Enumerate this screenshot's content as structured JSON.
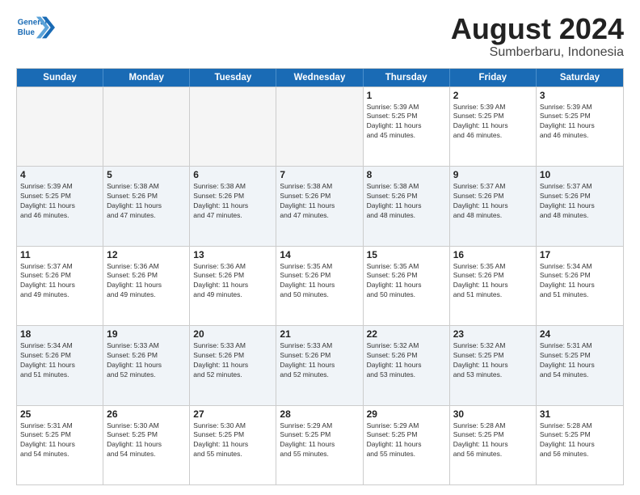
{
  "logo": {
    "text_general": "General",
    "text_blue": "Blue"
  },
  "title": "August 2024",
  "subtitle": "Sumberbaru, Indonesia",
  "days_of_week": [
    "Sunday",
    "Monday",
    "Tuesday",
    "Wednesday",
    "Thursday",
    "Friday",
    "Saturday"
  ],
  "weeks": [
    [
      {
        "day": "",
        "empty": true,
        "info": ""
      },
      {
        "day": "",
        "empty": true,
        "info": ""
      },
      {
        "day": "",
        "empty": true,
        "info": ""
      },
      {
        "day": "",
        "empty": true,
        "info": ""
      },
      {
        "day": "1",
        "info": "Sunrise: 5:39 AM\nSunset: 5:25 PM\nDaylight: 11 hours\nand 45 minutes."
      },
      {
        "day": "2",
        "info": "Sunrise: 5:39 AM\nSunset: 5:25 PM\nDaylight: 11 hours\nand 46 minutes."
      },
      {
        "day": "3",
        "info": "Sunrise: 5:39 AM\nSunset: 5:25 PM\nDaylight: 11 hours\nand 46 minutes."
      }
    ],
    [
      {
        "day": "4",
        "info": "Sunrise: 5:39 AM\nSunset: 5:25 PM\nDaylight: 11 hours\nand 46 minutes."
      },
      {
        "day": "5",
        "info": "Sunrise: 5:38 AM\nSunset: 5:26 PM\nDaylight: 11 hours\nand 47 minutes."
      },
      {
        "day": "6",
        "info": "Sunrise: 5:38 AM\nSunset: 5:26 PM\nDaylight: 11 hours\nand 47 minutes."
      },
      {
        "day": "7",
        "info": "Sunrise: 5:38 AM\nSunset: 5:26 PM\nDaylight: 11 hours\nand 47 minutes."
      },
      {
        "day": "8",
        "info": "Sunrise: 5:38 AM\nSunset: 5:26 PM\nDaylight: 11 hours\nand 48 minutes."
      },
      {
        "day": "9",
        "info": "Sunrise: 5:37 AM\nSunset: 5:26 PM\nDaylight: 11 hours\nand 48 minutes."
      },
      {
        "day": "10",
        "info": "Sunrise: 5:37 AM\nSunset: 5:26 PM\nDaylight: 11 hours\nand 48 minutes."
      }
    ],
    [
      {
        "day": "11",
        "info": "Sunrise: 5:37 AM\nSunset: 5:26 PM\nDaylight: 11 hours\nand 49 minutes."
      },
      {
        "day": "12",
        "info": "Sunrise: 5:36 AM\nSunset: 5:26 PM\nDaylight: 11 hours\nand 49 minutes."
      },
      {
        "day": "13",
        "info": "Sunrise: 5:36 AM\nSunset: 5:26 PM\nDaylight: 11 hours\nand 49 minutes."
      },
      {
        "day": "14",
        "info": "Sunrise: 5:35 AM\nSunset: 5:26 PM\nDaylight: 11 hours\nand 50 minutes."
      },
      {
        "day": "15",
        "info": "Sunrise: 5:35 AM\nSunset: 5:26 PM\nDaylight: 11 hours\nand 50 minutes."
      },
      {
        "day": "16",
        "info": "Sunrise: 5:35 AM\nSunset: 5:26 PM\nDaylight: 11 hours\nand 51 minutes."
      },
      {
        "day": "17",
        "info": "Sunrise: 5:34 AM\nSunset: 5:26 PM\nDaylight: 11 hours\nand 51 minutes."
      }
    ],
    [
      {
        "day": "18",
        "info": "Sunrise: 5:34 AM\nSunset: 5:26 PM\nDaylight: 11 hours\nand 51 minutes."
      },
      {
        "day": "19",
        "info": "Sunrise: 5:33 AM\nSunset: 5:26 PM\nDaylight: 11 hours\nand 52 minutes."
      },
      {
        "day": "20",
        "info": "Sunrise: 5:33 AM\nSunset: 5:26 PM\nDaylight: 11 hours\nand 52 minutes."
      },
      {
        "day": "21",
        "info": "Sunrise: 5:33 AM\nSunset: 5:26 PM\nDaylight: 11 hours\nand 52 minutes."
      },
      {
        "day": "22",
        "info": "Sunrise: 5:32 AM\nSunset: 5:26 PM\nDaylight: 11 hours\nand 53 minutes."
      },
      {
        "day": "23",
        "info": "Sunrise: 5:32 AM\nSunset: 5:25 PM\nDaylight: 11 hours\nand 53 minutes."
      },
      {
        "day": "24",
        "info": "Sunrise: 5:31 AM\nSunset: 5:25 PM\nDaylight: 11 hours\nand 54 minutes."
      }
    ],
    [
      {
        "day": "25",
        "info": "Sunrise: 5:31 AM\nSunset: 5:25 PM\nDaylight: 11 hours\nand 54 minutes."
      },
      {
        "day": "26",
        "info": "Sunrise: 5:30 AM\nSunset: 5:25 PM\nDaylight: 11 hours\nand 54 minutes."
      },
      {
        "day": "27",
        "info": "Sunrise: 5:30 AM\nSunset: 5:25 PM\nDaylight: 11 hours\nand 55 minutes."
      },
      {
        "day": "28",
        "info": "Sunrise: 5:29 AM\nSunset: 5:25 PM\nDaylight: 11 hours\nand 55 minutes."
      },
      {
        "day": "29",
        "info": "Sunrise: 5:29 AM\nSunset: 5:25 PM\nDaylight: 11 hours\nand 55 minutes."
      },
      {
        "day": "30",
        "info": "Sunrise: 5:28 AM\nSunset: 5:25 PM\nDaylight: 11 hours\nand 56 minutes."
      },
      {
        "day": "31",
        "info": "Sunrise: 5:28 AM\nSunset: 5:25 PM\nDaylight: 11 hours\nand 56 minutes."
      }
    ]
  ]
}
